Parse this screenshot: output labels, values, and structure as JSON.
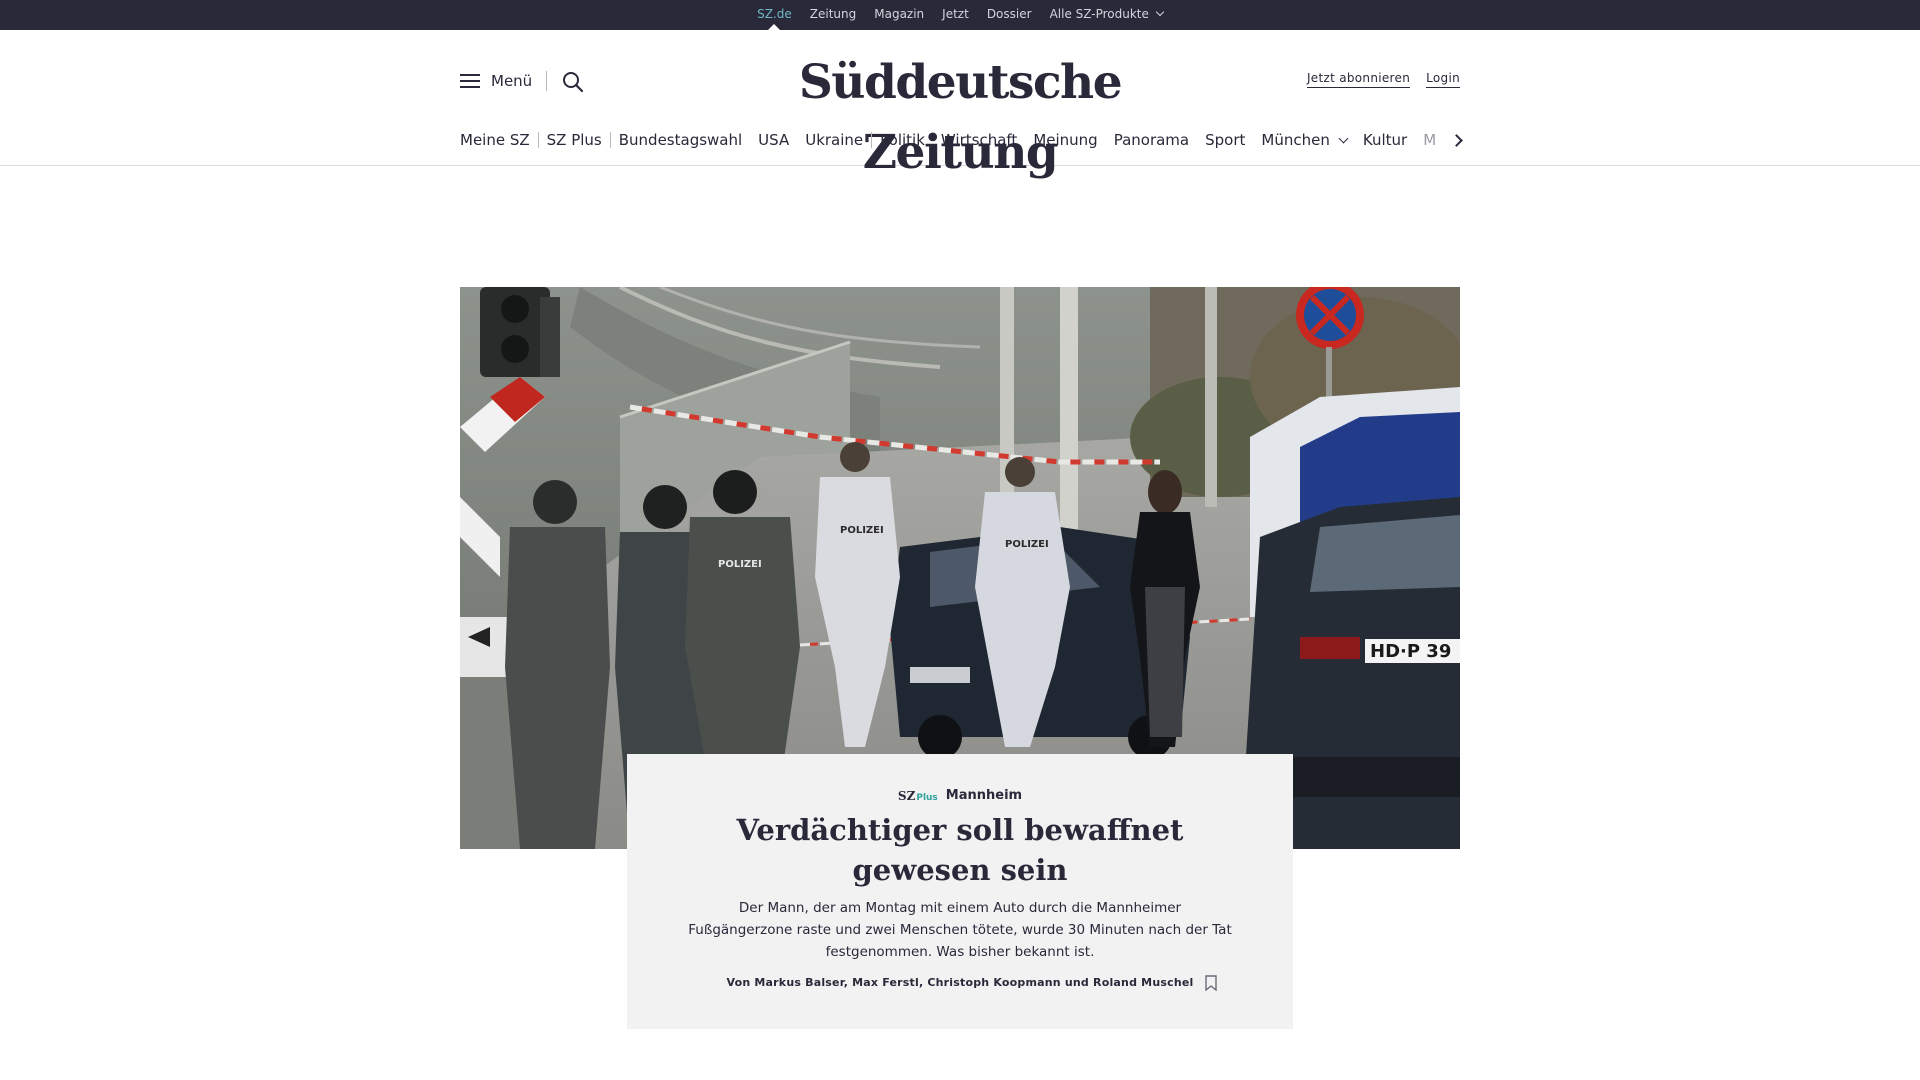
{
  "topbar": {
    "items": [
      "SZ.de",
      "Zeitung",
      "Magazin",
      "Jetzt",
      "Dossier",
      "Alle SZ-Produkte"
    ],
    "active": "SZ.de"
  },
  "header": {
    "menu_label": "Menü",
    "logo_text": "Süddeutsche Zeitung",
    "subscribe_label": "Jetzt abonnieren",
    "login_label": "Login"
  },
  "nav": {
    "items": [
      "Meine SZ",
      "SZ Plus",
      "Bundestagswahl",
      "USA",
      "Ukraine",
      "Politik",
      "Wirtschaft",
      "Meinung",
      "Panorama",
      "Sport",
      "München",
      "Kultur",
      "M"
    ]
  },
  "teaser": {
    "badge_sz": "SZ",
    "badge_plus": "Plus",
    "kicker": "Mannheim",
    "headline": "Verdächtiger soll bewaffnet gewesen sein",
    "text": "Der Mann, der am Montag mit einem Auto durch die Mannheimer Fußgängerzone raste und zwei Menschen tötete, wurde 30 Minuten nach der Tat festgenommen. Was bisher bekannt ist.",
    "byline": "Von Markus Balser, Max Ferstl, Christoph Koopmann und Roland Muschel"
  },
  "hero": {
    "police_label": "POLIZEI",
    "plate_text": "HD·P 39"
  },
  "colors": {
    "topbar_bg": "#29293a",
    "accent": "#71b8c4",
    "card_bg": "#f2f2f2",
    "sz_plus": "#2fa19a"
  }
}
